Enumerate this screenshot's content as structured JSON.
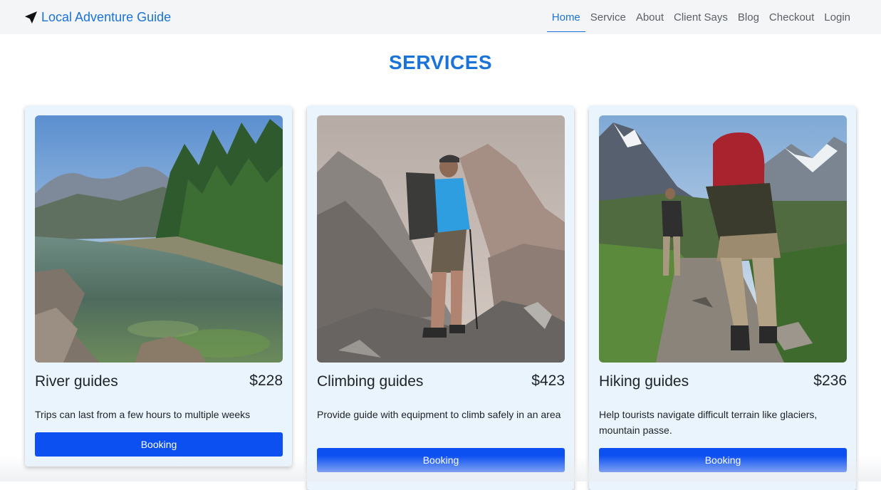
{
  "brand": {
    "name": "Local Adventure Guide",
    "icon": "rocket-plane-icon"
  },
  "nav": {
    "items": [
      {
        "label": "Home",
        "active": true
      },
      {
        "label": "Service"
      },
      {
        "label": "About"
      },
      {
        "label": "Client Says"
      },
      {
        "label": "Blog"
      },
      {
        "label": "Checkout"
      },
      {
        "label": "Login"
      }
    ]
  },
  "section": {
    "title": "SERVICES"
  },
  "services": [
    {
      "name": "River guides",
      "price": "$228",
      "description": "Trips can last from a few hours to multiple weeks",
      "button": "Booking",
      "image": "river-valley-photo"
    },
    {
      "name": "Climbing guides",
      "price": "$423",
      "description": "Provide guide with equipment to climb safely in an area",
      "button": "Booking",
      "image": "climber-on-ridge-photo"
    },
    {
      "name": "Hiking guides",
      "price": "$236",
      "description": "Help tourists navigate difficult terrain like glaciers, mountain passe.",
      "button": "Booking",
      "image": "hikers-on-trail-photo"
    }
  ],
  "colors": {
    "accent": "#1a73d9",
    "button": "#0d50f2",
    "card_bg": "#e9f4fd",
    "navbar_bg": "#f4f5f7"
  }
}
